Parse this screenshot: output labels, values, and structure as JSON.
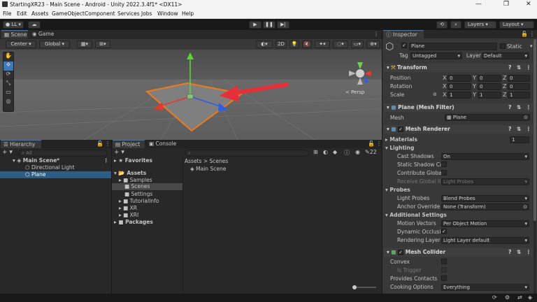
{
  "window": {
    "title": "StartingXR23 - Main Scene - Android - Unity 2022.3.4f1* <DX11>",
    "minimize": "—",
    "maximize": "❐",
    "close": "✕"
  },
  "menu": [
    "File",
    "Edit",
    "Assets",
    "GameObject",
    "Component",
    "Services",
    "Jobs",
    "Window",
    "Help"
  ],
  "toolbar": {
    "account": "LL",
    "layers": "Layers",
    "layout": "Layout"
  },
  "scene": {
    "tab_scene": "Scene",
    "tab_game": "Game",
    "pivot": "Center",
    "space": "Global",
    "mode2d": "2D",
    "persp": "< Persp"
  },
  "hierarchy": {
    "tab": "Hierarchy",
    "search": "All",
    "scene": "Main Scene*",
    "items": [
      "Directional Light",
      "Plane"
    ]
  },
  "project": {
    "tab_project": "Project",
    "tab_console": "Console",
    "favorites": "Favorites",
    "assets": "Assets",
    "folders": [
      "Samples",
      "Scenes",
      "Settings",
      "TutorialInfo",
      "XR",
      "XRI"
    ],
    "packages": "Packages",
    "breadcrumb_root": "Assets",
    "breadcrumb_sep": ">",
    "breadcrumb_leaf": "Scenes",
    "file": "Main Scene",
    "count": "22"
  },
  "inspector": {
    "tab": "Inspector",
    "object_name": "Plane",
    "static_label": "Static",
    "tag_label": "Tag",
    "tag": "Untagged",
    "layer_label": "Layer",
    "layer": "Default",
    "transform": {
      "title": "Transform",
      "rows": [
        {
          "label": "Position",
          "x": "0",
          "y": "0",
          "z": "0"
        },
        {
          "label": "Rotation",
          "x": "0",
          "y": "0",
          "z": "0"
        },
        {
          "label": "Scale",
          "x": "1",
          "y": "1",
          "z": "1"
        }
      ]
    },
    "mesh_filter": {
      "title": "Plane (Mesh Filter)",
      "mesh_label": "Mesh",
      "mesh": "Plane"
    },
    "mesh_renderer": {
      "title": "Mesh Renderer",
      "materials_label": "Materials",
      "materials_count": "1",
      "lighting": "Lighting",
      "cast_label": "Cast Shadows",
      "cast": "On",
      "static_shadow": "Static Shadow Ca",
      "contribute": "Contribute Global",
      "receive_label": "Receive Global Ill",
      "receive": "Light Probes",
      "probes": "Probes",
      "light_probes_label": "Light Probes",
      "light_probes": "Blend Probes",
      "anchor_label": "Anchor Override",
      "anchor": "None (Transform)",
      "additional": "Additional Settings",
      "motion_label": "Motion Vectors",
      "motion": "Per Object Motion",
      "dynamic_label": "Dynamic Occlusio",
      "rendering_label": "Rendering Layer M",
      "rendering": "Light Layer default"
    },
    "mesh_collider": {
      "title": "Mesh Collider",
      "convex": "Convex",
      "trigger": "Is Trigger",
      "contacts": "Provides Contacts",
      "cooking_label": "Cooking Options",
      "cooking": "Everything"
    }
  },
  "colors": {
    "accent": "#3a79bb",
    "selection": "#2c5d87",
    "arrow": "#e5303a",
    "plane_outline": "#f07a1a"
  }
}
